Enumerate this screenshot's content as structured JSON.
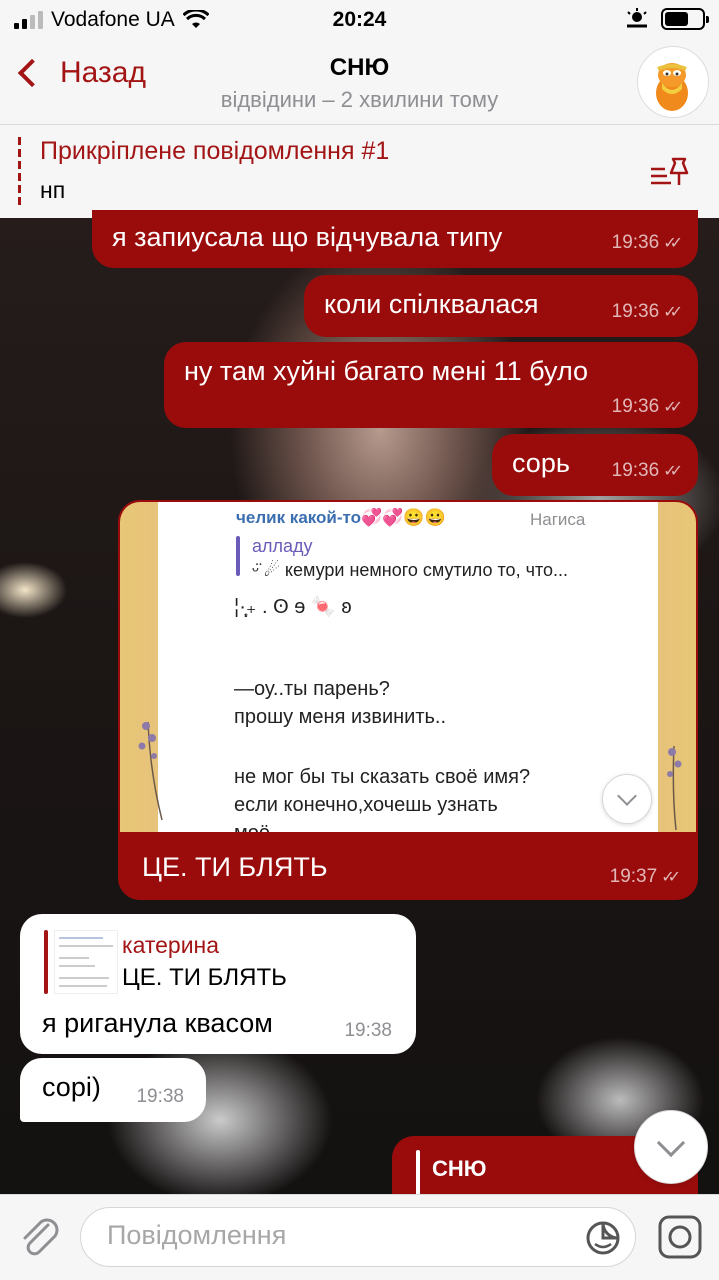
{
  "status_bar": {
    "carrier": "Vodafone UA",
    "time": "20:24"
  },
  "header": {
    "back_label": "Назад",
    "title": "СНЮ",
    "subtitle": "відвідини – 2 хвилини тому"
  },
  "pinned": {
    "title": "Прикріплене повідомлення #1",
    "text": "нп"
  },
  "messages": [
    {
      "text": "я запиусала що відчувала типу",
      "time": "19:36"
    },
    {
      "text": "коли спілквалася",
      "time": "19:36"
    },
    {
      "text": "ну там хуйні багато мені 11 було",
      "time": "19:36"
    },
    {
      "text": "сорь",
      "time": "19:36"
    },
    {
      "caption": "ЦЕ. ТИ БЛЯТЬ",
      "time": "19:37",
      "screenshot": {
        "sender": "челик какой-то💞💞😀😀",
        "sender_right": "Нагиса",
        "reply_name": "алладу",
        "reply_text": "ᵕ̈ ☄ кемури немного смутило то, что...",
        "decor": "¦·̩͙₊ . ʘ ɘ 🍬 ʚ",
        "line1": "—оу..ты парень?",
        "line2": "прошу меня извинить..",
        "line3": "не мог бы ты сказать своё имя?",
        "line4": "если конечно,хочешь узнать",
        "line5": "моё"
      }
    },
    {
      "reply_name": "катерина",
      "reply_text": "ЦЕ. ТИ БЛЯТЬ",
      "text": "я риганула квасом",
      "time": "19:38"
    },
    {
      "text": "сорі)",
      "time": "19:38"
    },
    {
      "partial_sender": "СНЮ"
    }
  ],
  "input": {
    "placeholder": "Повідомлення"
  },
  "colors": {
    "accent": "#a31515",
    "outgoing_bubble": "#9a0c0c",
    "bar_bg": "#f6f6f6"
  }
}
